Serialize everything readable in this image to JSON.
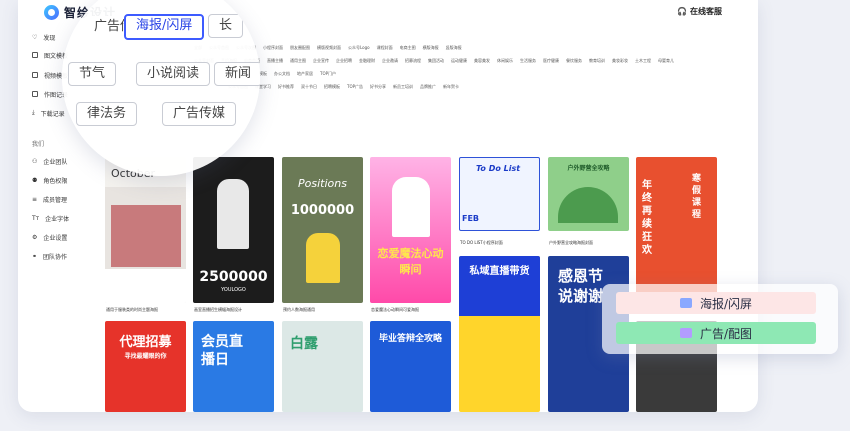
{
  "header": {
    "logo_text": "智绘设计",
    "service_label": "在线客服"
  },
  "sidebar": {
    "items": [
      {
        "label": "发现"
      },
      {
        "label": "图文模板"
      },
      {
        "label": "视频模板"
      },
      {
        "label": "作图记录"
      },
      {
        "label": "下载记录"
      }
    ],
    "team_section": "我们",
    "team_items": [
      {
        "label": "企业团队"
      },
      {
        "label": "角色权限"
      },
      {
        "label": "成员管理"
      },
      {
        "label": "企业字体"
      },
      {
        "label": "企业设置"
      },
      {
        "label": "团队协作"
      }
    ]
  },
  "tags": {
    "row1": [
      "全部",
      "公众号首图",
      "公众号次图",
      "小程序封面",
      "朋友圈配图",
      "横版视频封面",
      "公众号Logo",
      "课程封面",
      "电商主图",
      "横版海报",
      "竖版海报"
    ],
    "row2": [
      "公众号封面",
      "手机海报",
      "电商首页",
      "直播主播",
      "通用主图",
      "企业宣传",
      "企业招聘",
      "金融理财",
      "企业邀请",
      "招募流程",
      "集团活动",
      "运动健康",
      "美容美发",
      "休闲娱乐",
      "生活服务",
      "医疗健康",
      "餐饮服务",
      "教育培训",
      "美妆彩妆",
      "土木工程",
      "母婴育儿"
    ],
    "row3": [
      "手机海报",
      "简历模板",
      "办公文档",
      "地产家居",
      "TOP门户"
    ],
    "row4": [
      "公众号首图",
      "课堂学习",
      "好书推荐",
      "双十节日",
      "招聘模板",
      "TOP广告",
      "好书分享",
      "新员工培训",
      "品牌推广",
      "新年贺卡"
    ]
  },
  "magnifier": {
    "chips": [
      "海报/闪屏",
      "长",
      "节气",
      "小说阅读",
      "新闻",
      "律法务",
      "广告传媒"
    ]
  },
  "cards": [
    {
      "title_en": "October",
      "caption": "通用于服装类的时尚主题海报",
      "bg": "#e8e4e0"
    },
    {
      "title": "2500000",
      "sub": "YOULOGO",
      "caption": "画室直播招生横幅海报设计",
      "bg": "#1c1c1c"
    },
    {
      "title_en": "Positions",
      "num": "1000000",
      "caption": "预约人数海报通用",
      "bg": "#6b7a56"
    },
    {
      "title": "恋爱魔法心动瞬间",
      "caption": "恋爱魔法心动瞬间可爱海报",
      "bg": "#ff5fb4"
    },
    {
      "title": "To Do List",
      "date": "FEB",
      "caption": "TO DO LIST小程序封面",
      "bg": "#e9f0ff"
    },
    {
      "title": "户外野营全攻略",
      "caption": "户外野营全攻略海报封面",
      "bg": "#7bc67d"
    },
    {
      "title": "年终再续狂欢",
      "right": "寒假课程",
      "caption": "",
      "bg": "#e8502f"
    },
    {
      "title": "代理招募",
      "sub": "寻找最耀眼的你",
      "caption": "",
      "bg": "#e6332a"
    },
    {
      "title": "会员直播日",
      "caption": "",
      "bg": "#2a7ae4"
    },
    {
      "title": "白露",
      "caption": "",
      "bg": "#dce8e6"
    },
    {
      "title": "毕业答辩全攻略",
      "caption": "",
      "bg": "#1e5bd8"
    },
    {
      "title": "私域直播带货",
      "caption": "",
      "bg": "#ffd52b"
    },
    {
      "title": "感恩节说谢谢",
      "caption": "",
      "bg": "#1f3f99"
    },
    {
      "title": "",
      "caption": "",
      "bg": "#3a3a3a"
    }
  ],
  "popup": {
    "items": [
      {
        "label": "海报/闪屏"
      },
      {
        "label": "广告/配图"
      }
    ]
  }
}
